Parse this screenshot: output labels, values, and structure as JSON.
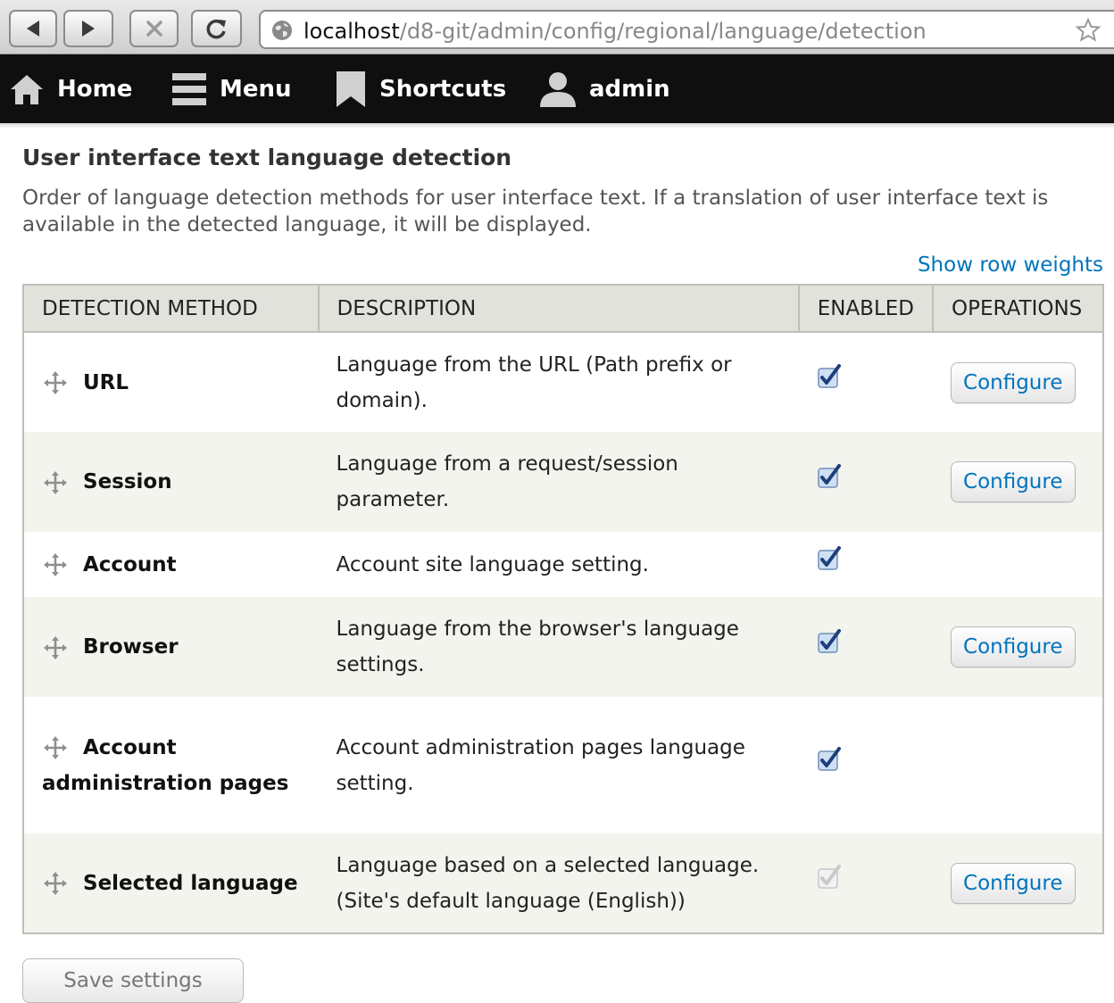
{
  "browser": {
    "url_host": "localhost",
    "url_path": "/d8-git/admin/config/regional/language/detection"
  },
  "toolbar": {
    "home": "Home",
    "menu": "Menu",
    "shortcuts": "Shortcuts",
    "user": "admin"
  },
  "page": {
    "title": "User interface text language detection",
    "description": "Order of language detection methods for user interface text. If a translation of user interface text is available in the detected language, it will be displayed.",
    "show_row_weights": "Show row weights",
    "save_button": "Save settings"
  },
  "table": {
    "headers": [
      "Detection method",
      "Description",
      "Enabled",
      "Operations"
    ],
    "rows": [
      {
        "method": "URL",
        "description": "Language from the URL (Path prefix or domain).",
        "enabled": true,
        "disabled": false,
        "operation": "Configure"
      },
      {
        "method": "Session",
        "description": "Language from a request/session parameter.",
        "enabled": true,
        "disabled": false,
        "operation": "Configure"
      },
      {
        "method": "Account",
        "description": "Account site language setting.",
        "enabled": true,
        "disabled": false,
        "operation": ""
      },
      {
        "method": "Browser",
        "description": "Language from the browser's language settings.",
        "enabled": true,
        "disabled": false,
        "operation": "Configure"
      },
      {
        "method": "Account administration pages",
        "description": "Account administration pages language setting.",
        "enabled": true,
        "disabled": false,
        "operation": ""
      },
      {
        "method": "Selected language",
        "description": "Language based on a selected language. (Site's default language (English))",
        "enabled": true,
        "disabled": true,
        "operation": "Configure"
      }
    ]
  },
  "colors": {
    "link": "#0074bd",
    "toolbar_bg": "#0f0f0f",
    "header_bg": "#e1e2dc",
    "row_alt_bg": "#f3f4ee"
  }
}
